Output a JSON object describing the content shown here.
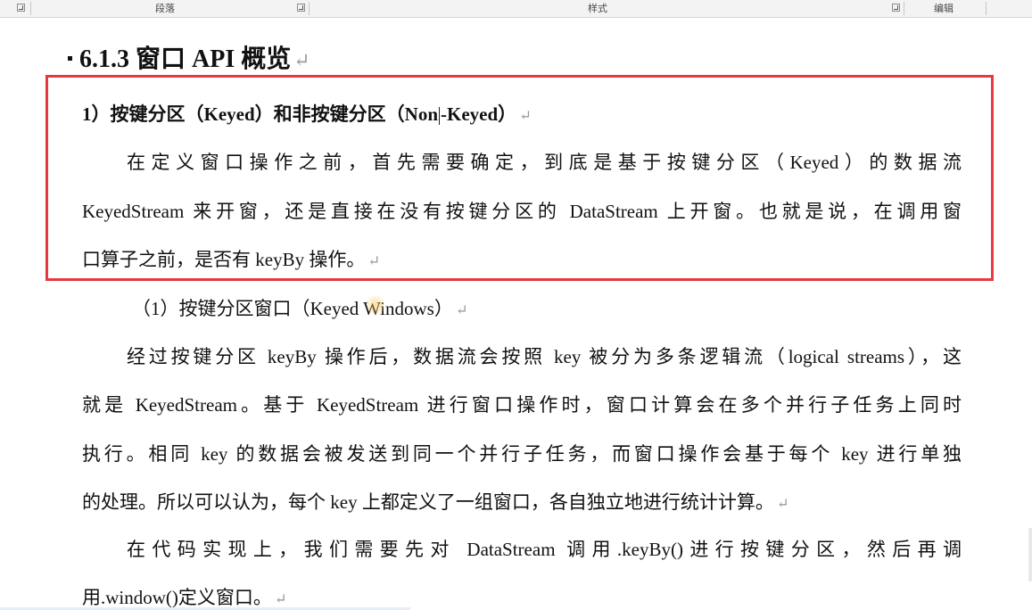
{
  "ribbon": {
    "groups": [
      {
        "label": "段落"
      },
      {
        "label": "样式"
      },
      {
        "label": "编辑"
      }
    ],
    "launcher_glyph": "↘"
  },
  "document": {
    "heading": "6.1.3 窗口 API 概览",
    "paragraph_mark": "↵",
    "section1_title_a": "1）按键分区（Keyed）和非按键分区（Non",
    "section1_title_b": "-Keyed）",
    "section1_lines": [
      "在定义窗口操作之前，首先需要确定，到底是基于按键分区（Keyed）的数据流",
      "KeyedStream 来开窗，还是直接在没有按键分区的 DataStream 上开窗。也就是说，在调用窗",
      "口算子之前，是否有 keyBy 操作。"
    ],
    "subsection1_title": "（1）按键分区窗口（Keyed Windows）",
    "para2_lines": [
      "经过按键分区 keyBy 操作后，数据流会按照 key 被分为多条逻辑流（logical streams），这",
      "就是 KeyedStream。基于 KeyedStream 进行窗口操作时，窗口计算会在多个并行子任务上同时",
      "执行。相同 key 的数据会被发送到同一个并行子任务，而窗口操作会基于每个 key 进行单独",
      "的处理。所以可以认为，每个 key 上都定义了一组窗口，各自独立地进行统计计算。"
    ],
    "para3_lines": [
      "在代码实现上，我们需要先对 DataStream 调用.keyBy()进行按键分区，然后再调",
      "用.window()定义窗口。"
    ]
  },
  "colors": {
    "highlight_box": "#e53a40",
    "ribbon_bg": "#f3f3f3",
    "text": "#111111",
    "paragraph_mark": "#9a9a9a"
  }
}
